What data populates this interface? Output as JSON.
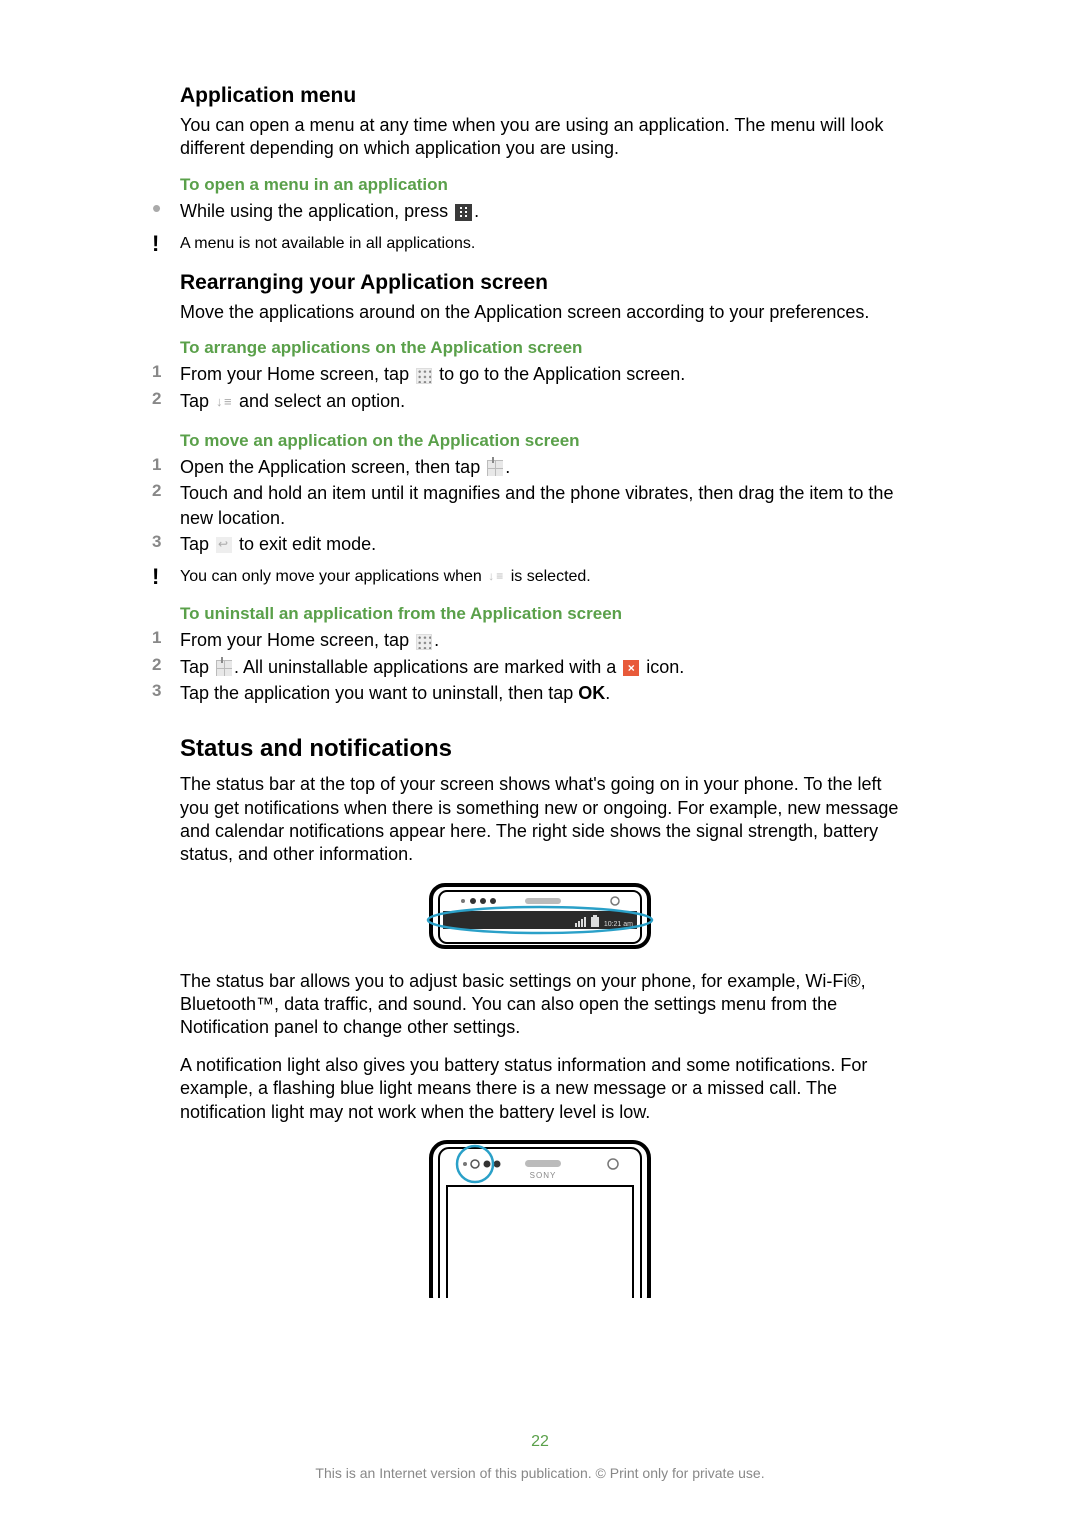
{
  "sections": {
    "appmenu": {
      "title": "Application menu",
      "intro": "You can open a menu at any time when you are using an application. The menu will look different depending on which application you are using.",
      "sub1": "To open a menu in an application",
      "step1_a": "While using the application, press ",
      "step1_b": ".",
      "note": "A menu is not available in all applications."
    },
    "rearrange": {
      "title": "Rearranging your Application screen",
      "intro": "Move the applications around on the Application screen according to your preferences.",
      "sub_arrange": "To arrange applications on the Application screen",
      "arr1_a": "From your Home screen, tap ",
      "arr1_b": " to go to the Application screen.",
      "arr2_a": "Tap ",
      "arr2_b": " and select an option.",
      "sub_move": "To move an application on the Application screen",
      "mv1_a": "Open the Application screen, then tap ",
      "mv1_b": ".",
      "mv2": "Touch and hold an item until it magnifies and the phone vibrates, then drag the item to the new location.",
      "mv3_a": "Tap ",
      "mv3_b": " to exit edit mode.",
      "mv_note_a": "You can only move your applications when ",
      "mv_note_b": " is selected.",
      "sub_uninstall": "To uninstall an application from the Application screen",
      "un1_a": "From your Home screen, tap ",
      "un1_b": ".",
      "un2_a": "Tap ",
      "un2_b": ". All uninstallable applications are marked with a ",
      "un2_c": " icon.",
      "un3_a": "Tap the application you want to uninstall, then tap ",
      "un3_ok": "OK",
      "un3_b": "."
    },
    "status": {
      "title": "Status and notifications",
      "p1": "The status bar at the top of your screen shows what's going on in your phone. To the left you get notifications when there is something new or ongoing. For example, new message and calendar notifications appear here. The right side shows the signal strength, battery status, and other information.",
      "p2": "The status bar allows you to adjust basic settings on your phone, for example, Wi‑Fi®, Bluetooth™, data traffic, and sound. You can also open the settings menu from the Notification panel to change other settings.",
      "p3": "A notification light also gives you battery status information and some notifications. For example, a flashing blue light means there is a new message or a missed call. The notification light may not work when the battery level is low.",
      "fig1_time": "10:21 am",
      "fig2_brand": "SONY"
    }
  },
  "markers": {
    "n1": "1",
    "n2": "2",
    "n3": "3",
    "bullet": "•",
    "bang": "!"
  },
  "page_number": "22",
  "footer": "This is an Internet version of this publication. © Print only for private use."
}
